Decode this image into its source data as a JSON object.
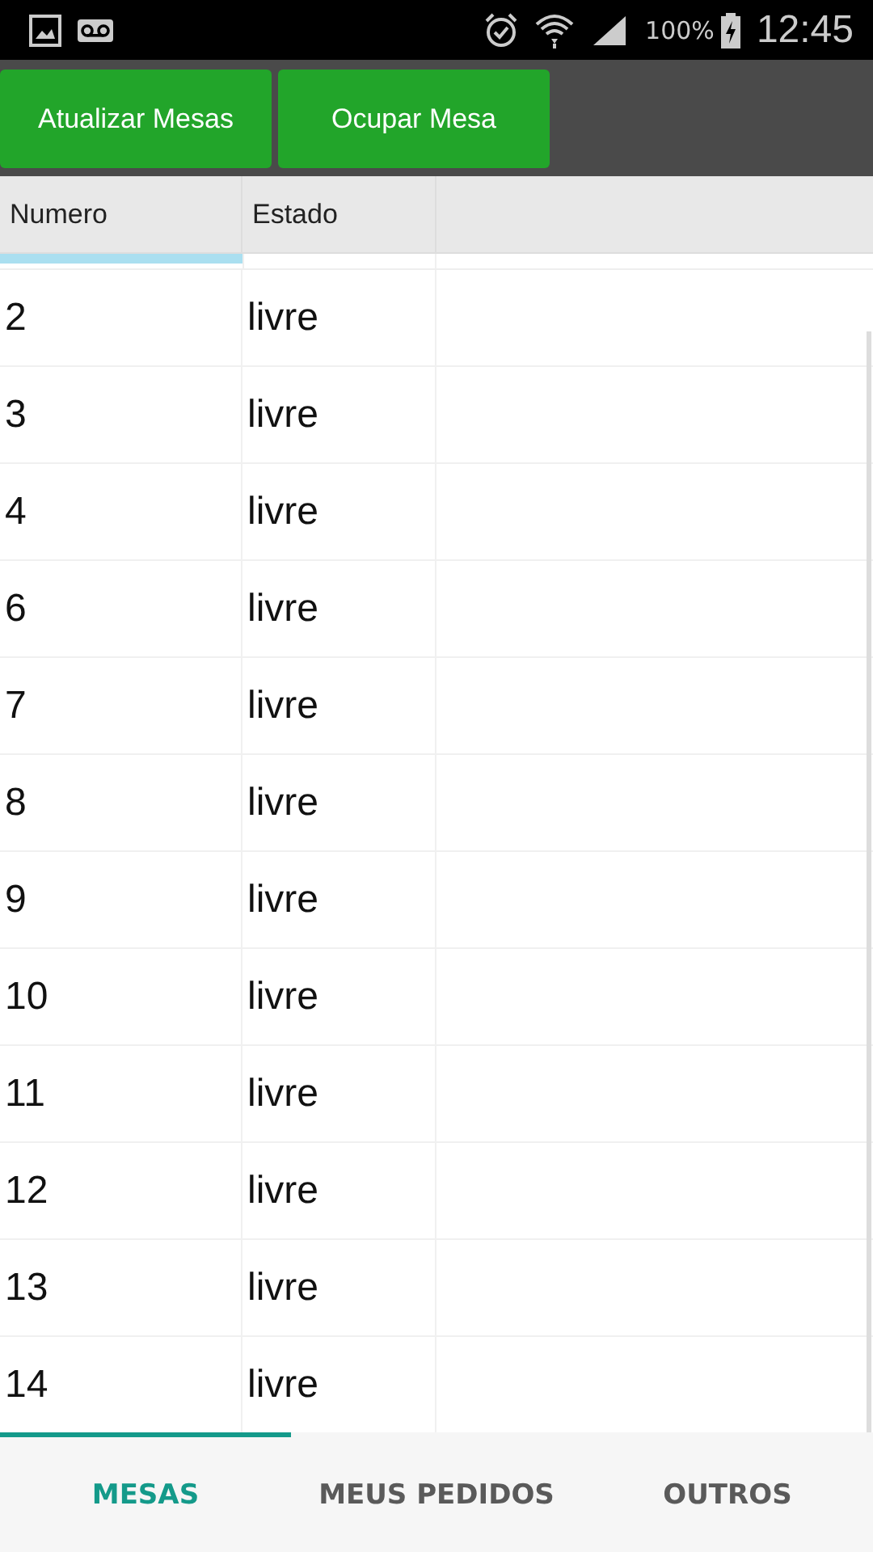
{
  "status_bar": {
    "battery": "100%",
    "time": "12:45"
  },
  "toolbar": {
    "buttons": [
      "Atualizar Mesas",
      "Ocupar Mesa"
    ]
  },
  "table": {
    "columns": [
      "Numero",
      "Estado"
    ],
    "rows": [
      {
        "numero": "2",
        "estado": "livre"
      },
      {
        "numero": "3",
        "estado": "livre"
      },
      {
        "numero": "4",
        "estado": "livre"
      },
      {
        "numero": "6",
        "estado": "livre"
      },
      {
        "numero": "7",
        "estado": "livre"
      },
      {
        "numero": "8",
        "estado": "livre"
      },
      {
        "numero": "9",
        "estado": "livre"
      },
      {
        "numero": "10",
        "estado": "livre"
      },
      {
        "numero": "11",
        "estado": "livre"
      },
      {
        "numero": "12",
        "estado": "livre"
      },
      {
        "numero": "13",
        "estado": "livre"
      },
      {
        "numero": "14",
        "estado": "livre"
      }
    ]
  },
  "tabs": [
    {
      "label": "MESAS",
      "selected": true
    },
    {
      "label": "MEUS PEDIDOS",
      "selected": false
    },
    {
      "label": "OUTROS",
      "selected": false
    }
  ]
}
